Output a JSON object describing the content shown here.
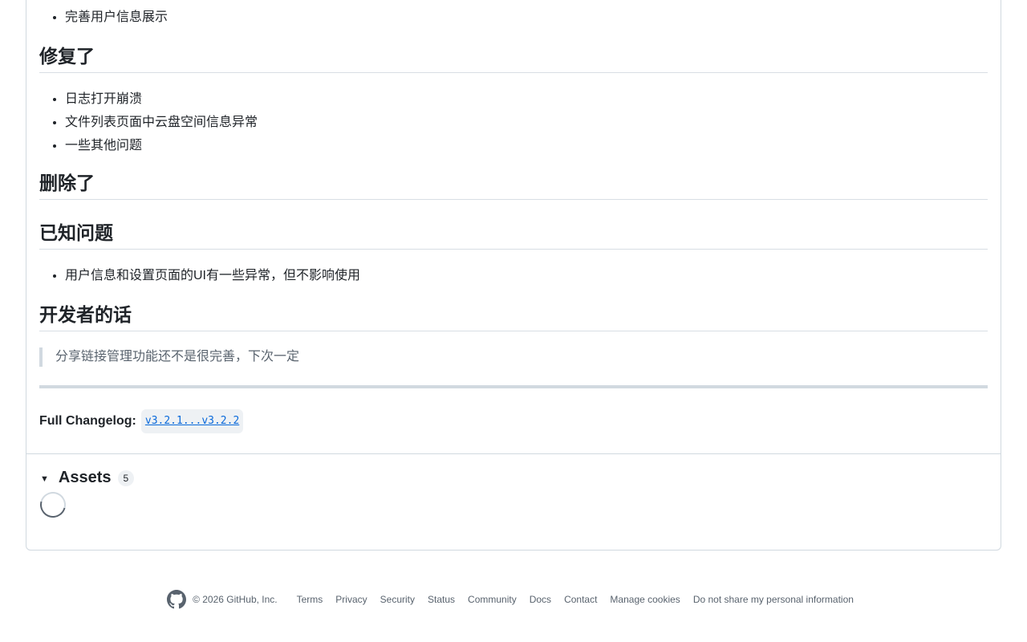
{
  "release": {
    "top_list": [
      "完善用户信息展示"
    ],
    "fixed": {
      "heading": "修复了",
      "items": [
        "日志打开崩溃",
        "文件列表页面中云盘空间信息异常",
        "一些其他问题"
      ]
    },
    "removed": {
      "heading": "删除了"
    },
    "known_issues": {
      "heading": "已知问题",
      "items": [
        "用户信息和设置页面的UI有一些异常，但不影响使用"
      ]
    },
    "dev_notes": {
      "heading": "开发者的话",
      "quote": "分享链接管理功能还不是很完善，下次一定"
    },
    "changelog": {
      "label": "Full Changelog:",
      "link_text": "v3.2.1...v3.2.2"
    }
  },
  "assets": {
    "title": "Assets",
    "count": "5",
    "caret": "▼"
  },
  "footer": {
    "copyright": "© 2026 GitHub, Inc.",
    "links": [
      "Terms",
      "Privacy",
      "Security",
      "Status",
      "Community",
      "Docs",
      "Contact",
      "Manage cookies",
      "Do not share my personal information"
    ]
  }
}
